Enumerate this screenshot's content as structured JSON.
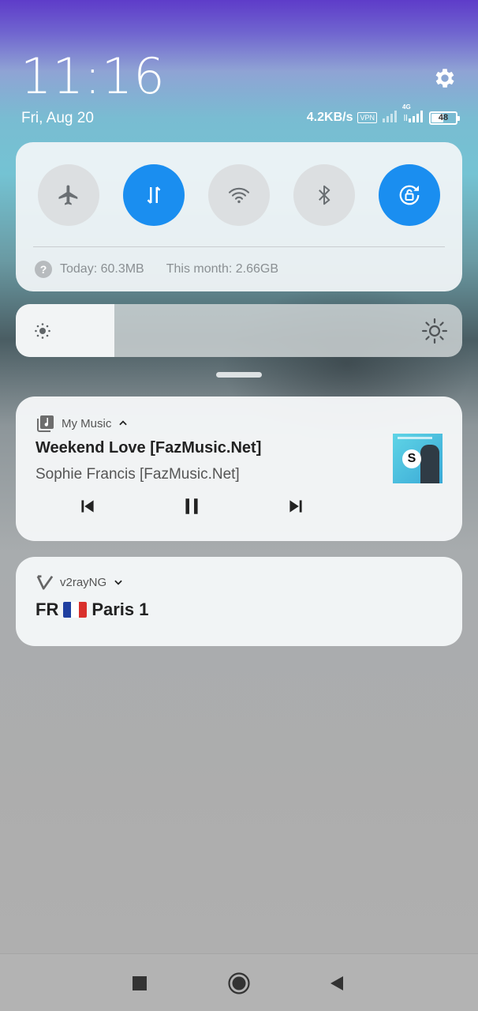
{
  "status": {
    "time": "11:16",
    "date": "Fri, Aug 20",
    "net_speed": "4.2KB/s",
    "vpn_badge": "VPN",
    "network_type": "4G",
    "battery": "48"
  },
  "quick_settings": {
    "toggles": [
      {
        "name": "Airplane mode",
        "icon": "airplane-icon",
        "active": false
      },
      {
        "name": "Mobile data",
        "icon": "data-transfer-icon",
        "active": true
      },
      {
        "name": "Wi-Fi",
        "icon": "wifi-icon",
        "active": false
      },
      {
        "name": "Bluetooth",
        "icon": "bluetooth-icon",
        "active": false
      },
      {
        "name": "Auto-rotate lock",
        "icon": "rotation-lock-icon",
        "active": true
      }
    ],
    "data_usage": {
      "help_glyph": "?",
      "today": "Today: 60.3MB",
      "this_month": "This month: 2.66GB"
    },
    "brightness_level": 0.22
  },
  "notifications": {
    "music": {
      "app_name": "My Music",
      "title": "Weekend Love [FazMusic.Net]",
      "artist": "Sophie Francis [FazMusic.Net]",
      "album_logo_glyph": "S",
      "controls": [
        "previous",
        "pause",
        "next"
      ]
    },
    "vpn": {
      "app_name": "v2rayNG",
      "server_code": "FR",
      "server_name": "Paris 1"
    }
  },
  "colors": {
    "accent": "#1a8ef0",
    "panel": "#f0f4f6",
    "toggle_off": "#dcdfe1"
  },
  "navigation": [
    "recents",
    "home",
    "back"
  ]
}
